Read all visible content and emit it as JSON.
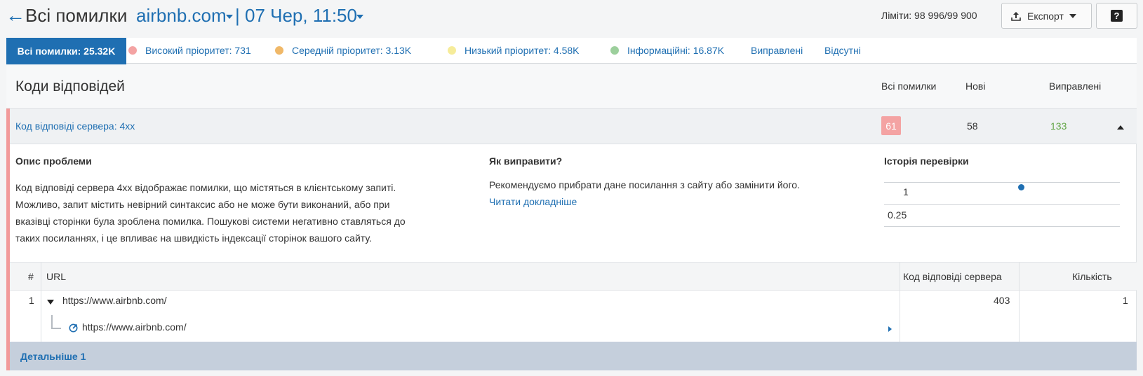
{
  "header": {
    "back_icon": "arrow-left-icon",
    "title": "Всі помилки",
    "domain": "airbnb.com",
    "separator": "|",
    "date": "07 Чер, 11:50",
    "limits": "Ліміти: 98 996/99 900",
    "export_label": "Експорт",
    "help_label": "?"
  },
  "tabs": {
    "active": "Всі помилки: 25.32K",
    "items": [
      {
        "label": "Високий пріоритет: 731",
        "color": "#f4a3a3"
      },
      {
        "label": "Середній пріоритет: 3.13K",
        "color": "#f0b868"
      },
      {
        "label": "Низький пріоритет: 4.58K",
        "color": "#f6ec9a"
      },
      {
        "label": "Інформаційні: 16.87K",
        "color": "#9ccf9c"
      }
    ],
    "fixed": "Виправлені",
    "missing": "Відсутні"
  },
  "card": {
    "title": "Коди відповідей",
    "col_all": "Всі помилки",
    "col_new": "Нові",
    "col_fixed": "Виправлені"
  },
  "issue": {
    "name": "Код відповіді сервера: 4xx",
    "all": "61",
    "new": "58",
    "fixed": "133"
  },
  "details": {
    "desc_heading": "Опис проблеми",
    "desc_lines": [
      "Код відповіді сервера 4xx відображає помилки, що містяться в клієнтському запиті.",
      "Можливо, запит містить невірний синтаксис або не може бути виконаний, або при",
      "вказівці сторінки була зроблена помилка. Пошукові системи негативно ставляться до",
      "таких посиланнях, і це впливає на швидкість індексації сторінок вашого сайту."
    ],
    "fix_heading": "Як виправити?",
    "fix_text": "Рекомендуємо прибрати дане посилання з сайту або замінити його.",
    "fix_link": "Читати докладніше",
    "history_heading": "Історія перевірки",
    "history_v1": "1",
    "history_v2": "0.25"
  },
  "table": {
    "headers": {
      "num": "#",
      "url": "URL",
      "code": "Код відповіді сервера",
      "count": "Кількість"
    },
    "rows": [
      {
        "num": "1",
        "url": "https://www.airbnb.com/",
        "child_url": "https://www.airbnb.com/",
        "code": "403",
        "count": "1"
      }
    ]
  },
  "footer": {
    "more": "Детальніше 1"
  }
}
